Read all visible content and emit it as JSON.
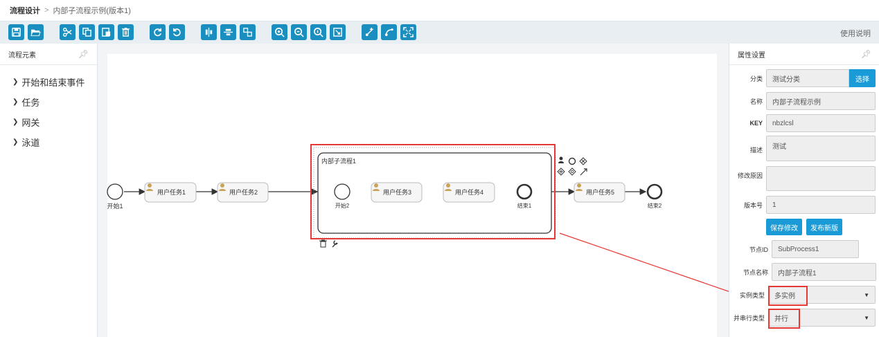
{
  "breadcrumb": {
    "root": "流程设计",
    "sep": ">",
    "current": "内部子流程示例(版本1)"
  },
  "toolbar": {
    "help_label": "使用说明",
    "buttons": [
      "save-icon",
      "open-folder-icon",
      "cut-icon",
      "copy-icon",
      "paste-icon",
      "delete-icon",
      "redo-icon",
      "undo-icon",
      "align-vertical-icon",
      "align-horizontal-icon",
      "same-size-icon",
      "zoom-in-icon",
      "zoom-out-icon",
      "zoom-actual-icon",
      "zoom-fit-icon",
      "connect-add-icon",
      "connect-edit-icon",
      "fullscreen-icon"
    ],
    "accent": "#1a8fbf"
  },
  "left_panel": {
    "title": "流程元素",
    "items": [
      {
        "label": "开始和结束事件"
      },
      {
        "label": "任务"
      },
      {
        "label": "网关"
      },
      {
        "label": "泳道"
      }
    ]
  },
  "canvas": {
    "start1": "开始1",
    "task1": "用户任务1",
    "task2": "用户任务2",
    "subprocess": "内部子流程1",
    "start2": "开始2",
    "task3": "用户任务3",
    "task4": "用户任务4",
    "end1": "结束1",
    "task5": "用户任务5",
    "end2": "结束2",
    "highlight_color": "#e53935"
  },
  "right_panel": {
    "title": "属性设置",
    "category_label": "分类",
    "category_value": "测试分类",
    "select_button": "选择",
    "name_label": "名称",
    "name_value": "内部子流程示例",
    "key_label": "KEY",
    "key_value": "nbzlcsl",
    "desc_label": "描述",
    "desc_value": "测试",
    "reason_label": "修改原因",
    "reason_value": "",
    "version_label": "版本号",
    "version_value": "1",
    "save_button": "保存修改",
    "publish_button": "发布新版",
    "node_id_label": "节点ID",
    "node_id_value": "SubProcess1",
    "node_name_label": "节点名称",
    "node_name_value": "内部子流程1",
    "instance_type_label": "实例类型",
    "instance_type_value": "多实例",
    "parallel_type_label": "并串行类型",
    "parallel_type_value": "并行"
  }
}
